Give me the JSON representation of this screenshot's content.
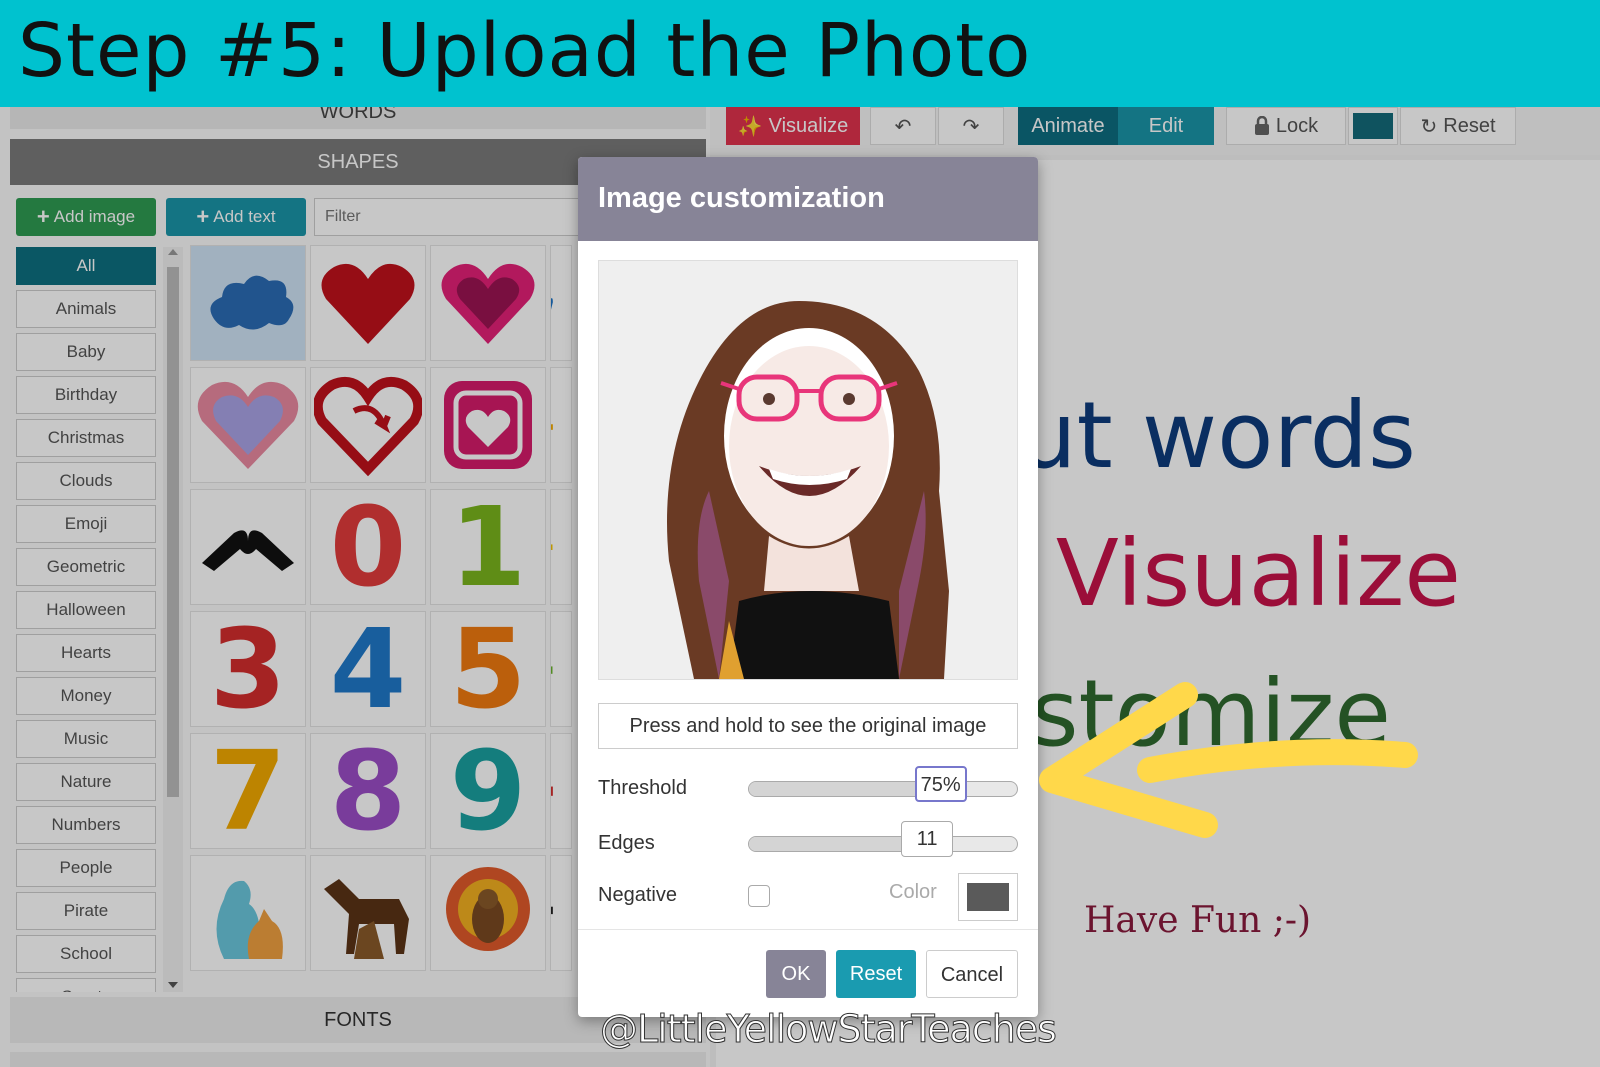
{
  "banner": {
    "title": "Step #5: Upload the Photo"
  },
  "left_panel": {
    "words_header": "WORDS",
    "shapes_header": "SHAPES",
    "fonts_header": "FONTS",
    "add_image_label": "Add image",
    "add_text_label": "Add text",
    "filter_placeholder": "Filter",
    "categories": [
      "All",
      "Animals",
      "Baby",
      "Birthday",
      "Christmas",
      "Clouds",
      "Emoji",
      "Geometric",
      "Halloween",
      "Hearts",
      "Money",
      "Music",
      "Nature",
      "Numbers",
      "People",
      "Pirate",
      "School",
      "Sports"
    ],
    "selected_category": "All",
    "shapes": [
      {
        "icon": "cloud-shape-icon",
        "color": "#2b6cb5"
      },
      {
        "icon": "heart-shape-icon",
        "color": "#c0111c"
      },
      {
        "icon": "heart-pink-shape-icon",
        "color": "#e52178"
      },
      {
        "icon": "heart-blue-partial-icon",
        "color": "#1a73c7"
      },
      {
        "icon": "heart-outline-lavender-icon",
        "color": "#e98aa0"
      },
      {
        "icon": "heart-arrow-shape-icon",
        "color": "#c0111c"
      },
      {
        "icon": "heart-square-shape-icon",
        "color": "#d61b6b"
      },
      {
        "icon": "partial-yellow-shape-icon",
        "color": "#f2a900"
      },
      {
        "icon": "hands-heart-shape-icon",
        "color": "#111111"
      },
      {
        "icon": "number-0",
        "label": "0",
        "color": "#e23b3b"
      },
      {
        "icon": "number-1",
        "label": "1",
        "color": "#7ab51d"
      },
      {
        "icon": "partial-yellow-2-icon",
        "color": "#f2c200"
      },
      {
        "icon": "number-3",
        "label": "3",
        "color": "#d42d2d"
      },
      {
        "icon": "number-4",
        "label": "4",
        "color": "#1f79c9"
      },
      {
        "icon": "number-5",
        "label": "5",
        "color": "#f07a10"
      },
      {
        "icon": "partial-green-icon",
        "color": "#6ab42e"
      },
      {
        "icon": "number-7",
        "label": "7",
        "color": "#f2a900"
      },
      {
        "icon": "number-8",
        "label": "8",
        "color": "#9c4ec7"
      },
      {
        "icon": "number-9",
        "label": "9",
        "color": "#1aa0a0"
      },
      {
        "icon": "partial-red-icon",
        "color": "#d42d2d"
      },
      {
        "icon": "dog-cat-blue-shape-icon",
        "color": "#6bc7dd"
      },
      {
        "icon": "dog-cat-brown-shape-icon",
        "color": "#5c3417"
      },
      {
        "icon": "turkey-shape-icon",
        "color": "#e05a2b"
      },
      {
        "icon": "partial-black-icon",
        "color": "#222222"
      }
    ]
  },
  "toolbar": {
    "visualize_label": "Visualize",
    "animate_label": "Animate",
    "edit_label": "Edit",
    "lock_label": "Lock",
    "reset_label": "Reset",
    "color": "#146b7a"
  },
  "canvas": {
    "line1": "ut words",
    "line2": "Visualize",
    "line3": "stomize",
    "line4": "Have Fun ;-)"
  },
  "modal": {
    "title": "Image customization",
    "press_hold_label": "Press and hold to see the original image",
    "threshold_label": "Threshold",
    "threshold_value": "75%",
    "threshold_fraction": 0.71,
    "edges_label": "Edges",
    "edges_value": "11",
    "edges_fraction": 0.66,
    "negative_label": "Negative",
    "color_label": "Color",
    "color_value": "#5a5a5a",
    "ok_label": "OK",
    "reset_label": "Reset",
    "cancel_label": "Cancel"
  },
  "annotation": {
    "arrow_color": "#ffd84a"
  },
  "watermark": "@LittleYellowStarTeaches"
}
